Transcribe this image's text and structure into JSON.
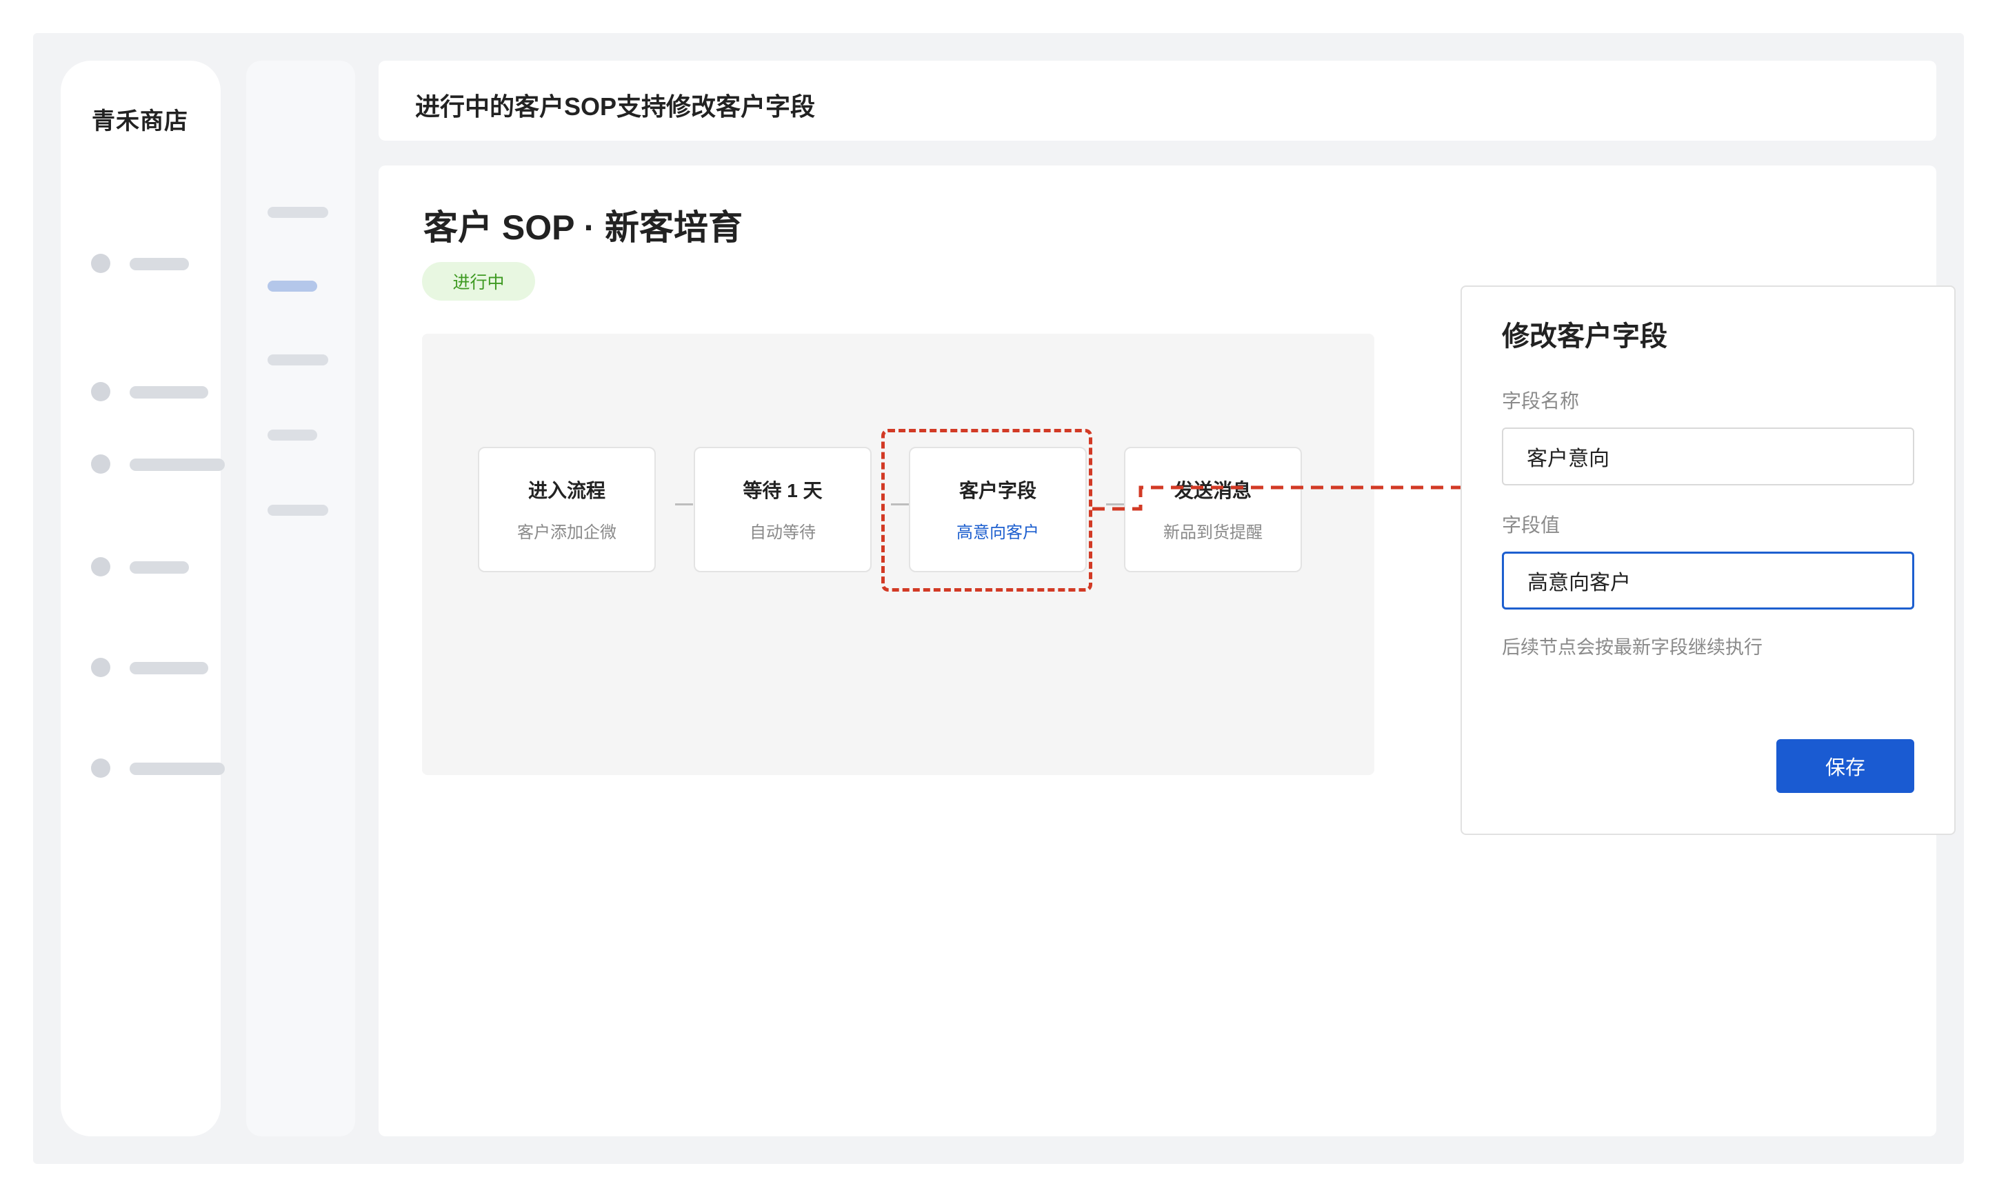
{
  "brand": {
    "name": "青禾商店"
  },
  "header": {
    "title": "进行中的客户SOP支持修改客户字段"
  },
  "page": {
    "title": "客户 SOP · 新客培育",
    "status": "进行中"
  },
  "flow": {
    "nodes": [
      {
        "title": "进入流程",
        "subtitle": "客户添加企微"
      },
      {
        "title": "等待 1 天",
        "subtitle": "自动等待"
      },
      {
        "title": "客户字段",
        "subtitle": "高意向客户"
      },
      {
        "title": "发送消息",
        "subtitle": "新品到货提醒"
      }
    ]
  },
  "panel": {
    "title": "修改客户字段",
    "field_name_label": "字段名称",
    "field_name_value": "客户意向",
    "field_value_label": "字段值",
    "field_value_value": "高意向客户",
    "hint": "后续节点会按最新字段继续执行",
    "save_label": "保存"
  },
  "colors": {
    "accent": "#1a5bd2",
    "highlight_dashed": "#d23a25",
    "status_bg": "#e8f7e1",
    "status_text": "#3e9a22"
  }
}
